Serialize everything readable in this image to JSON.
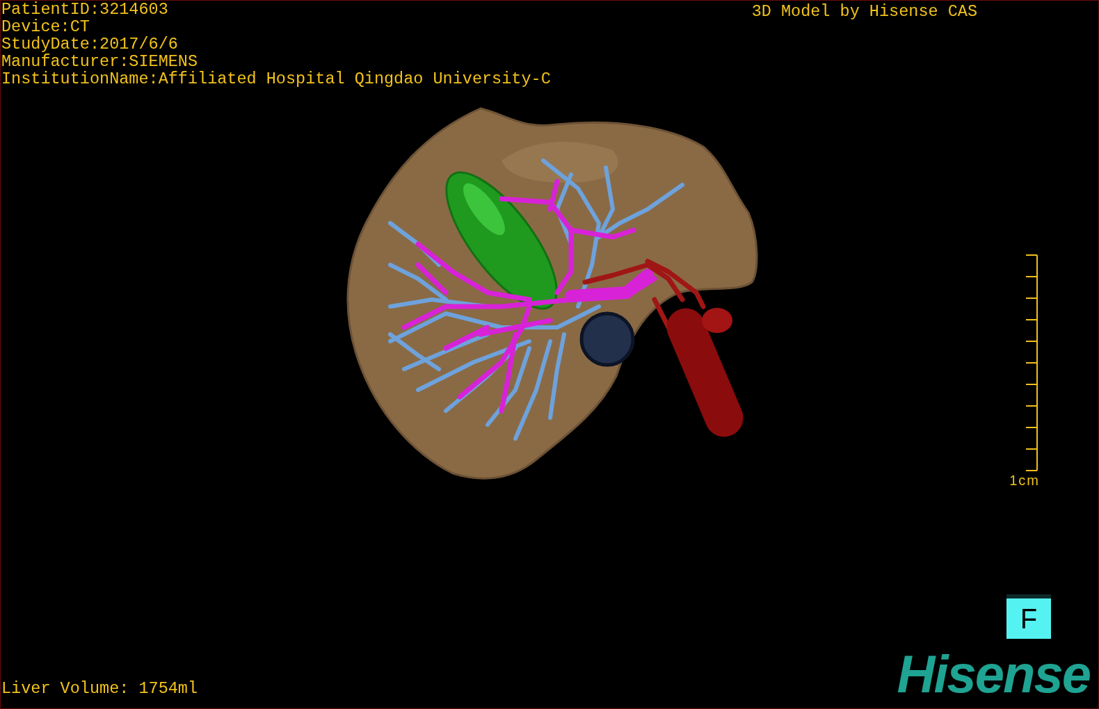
{
  "info_lines": [
    "PatientID:3214603",
    "Device:CT",
    "StudyDate:2017/6/6",
    "Manufacturer:SIEMENS",
    "InstitutionName:Affiliated Hospital Qingdao University-C"
  ],
  "title": "3D Model by Hisense CAS",
  "scale_bar": {
    "label": "1cm"
  },
  "orientation": {
    "label": "F"
  },
  "liver_volume": "Liver Volume: 1754ml",
  "logo": "Hisense"
}
